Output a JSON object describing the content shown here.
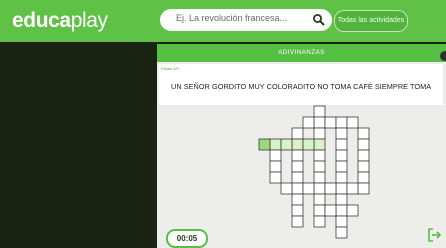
{
  "brand": {
    "part1": "educa",
    "part2": "play"
  },
  "search": {
    "placeholder": "Ej. La revolución francesa...",
    "icon": "search-icon"
  },
  "header": {
    "all_activities_label": "Todas las actividades"
  },
  "game": {
    "title": "ADIVINANZAS",
    "counter": "Pistas 1/9",
    "clue": "UN SEÑOR GORDITO MUY COLORADITO NO TOMA CAFÉ SIEMPRE TOMA",
    "timer": "00:05"
  },
  "colors": {
    "brand_green": "#5fc247",
    "panel_head": "#55c043",
    "active_cell": "#9bd87e",
    "active_word": "#d8f1c8",
    "background": "#1b2413"
  },
  "icons": {
    "exit": "exit-icon",
    "corner": "menu-dot-icon"
  }
}
